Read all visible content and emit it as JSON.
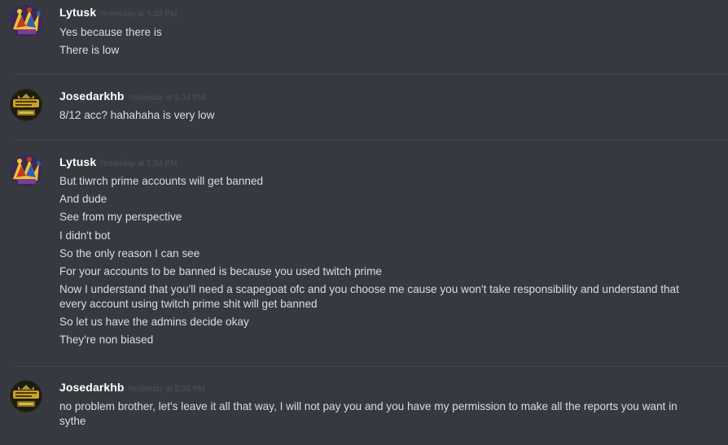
{
  "messages": [
    {
      "username": "Lytusk",
      "timestamp": "Yesterday at 5:33 PM",
      "avatar_icon": "jester-avatar-icon",
      "lines": [
        "Yes because there is",
        "There is low"
      ]
    },
    {
      "username": "Josedarkhb",
      "timestamp": "Yesterday at 5:34 PM",
      "avatar_icon": "gold-badge-avatar-icon",
      "lines": [
        "8/12 acc? hahahaha is very low"
      ]
    },
    {
      "username": "Lytusk",
      "timestamp": "Yesterday at 5:34 PM",
      "avatar_icon": "jester-avatar-icon",
      "lines": [
        "But tiwrch prime accounts will get banned",
        "And dude",
        "See from my perspective",
        "I didn't bot",
        "So the only reason I can see",
        "For your accounts to be banned is because you used twitch prime",
        "Now I understand that you'll need a scapegoat ofc and you choose me cause you won't take responsibility and understand that every account using twitch prime shit will get banned",
        "So let us have the admins decide okay",
        "They're non biased"
      ]
    },
    {
      "username": "Josedarkhb",
      "timestamp": "Yesterday at 5:35 PM",
      "avatar_icon": "gold-badge-avatar-icon",
      "lines": [
        "no problem brother, let's leave it all that way, I will not pay you and you have my permission to make all the reports you want in sythe"
      ]
    }
  ],
  "colors": {
    "background": "#36393f",
    "username": "#ffffff",
    "timestamp": "#4e5257",
    "message_text": "#dcddde",
    "divider": "#42454a"
  }
}
